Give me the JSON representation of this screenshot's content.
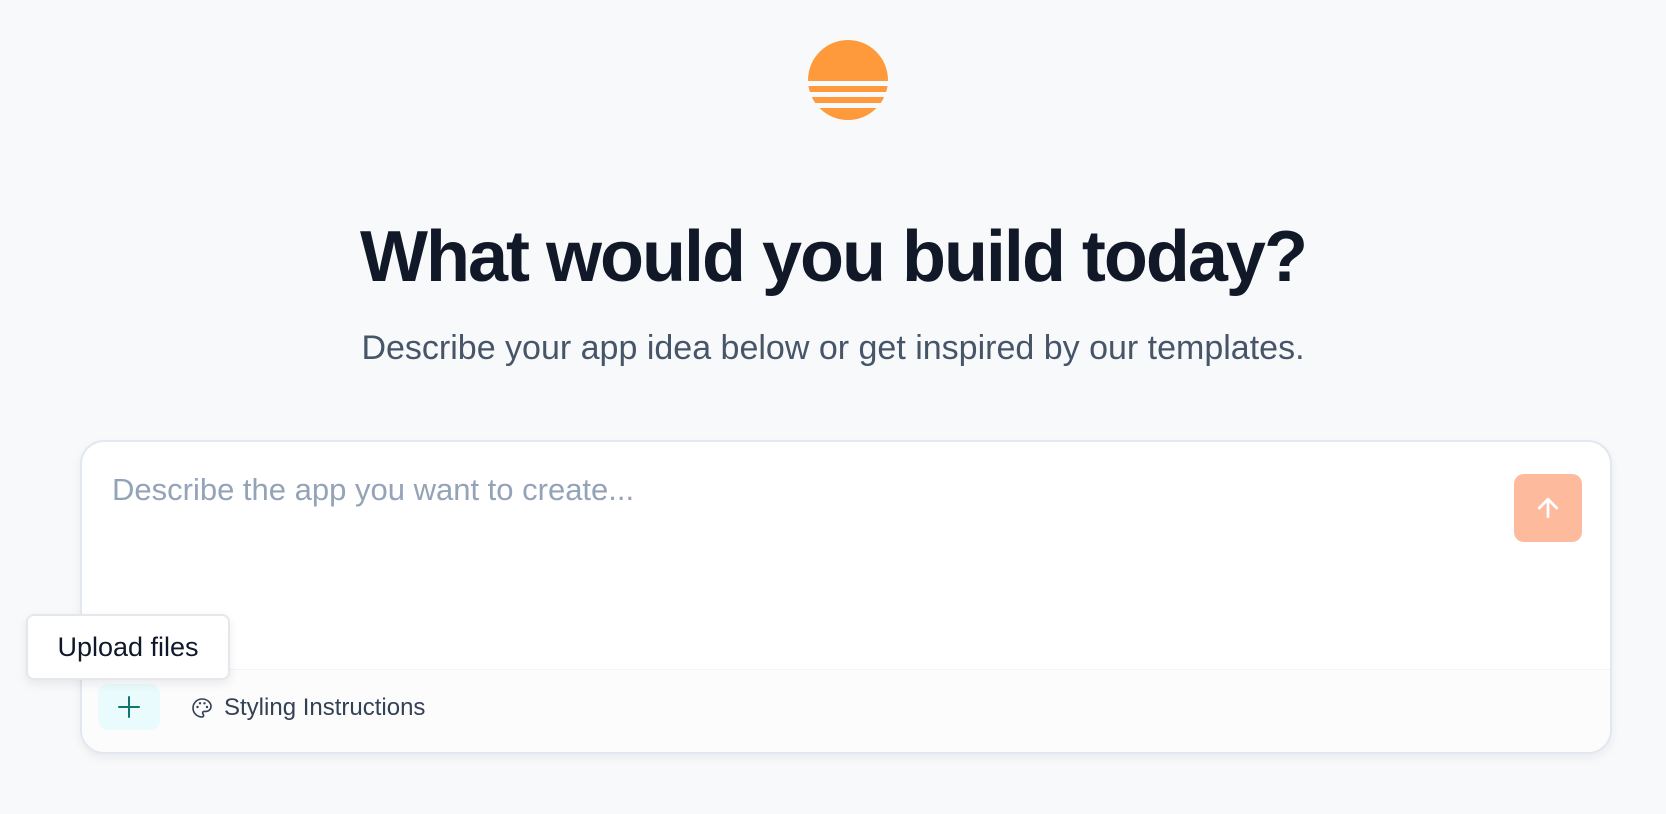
{
  "brand": {
    "logo_icon": "sun-horizon-logo",
    "accent_color": "#ff9a3c"
  },
  "hero": {
    "title": "What would you build today?",
    "subtitle": "Describe your app idea below or get inspired by our templates."
  },
  "composer": {
    "placeholder": "Describe the app you want to create...",
    "value": "",
    "send_icon": "arrow-up-icon",
    "send_color": "#fdba9c",
    "add_icon": "plus-icon",
    "styling_icon": "palette-icon",
    "styling_label": "Styling Instructions"
  },
  "tooltip": {
    "text": "Upload files"
  }
}
